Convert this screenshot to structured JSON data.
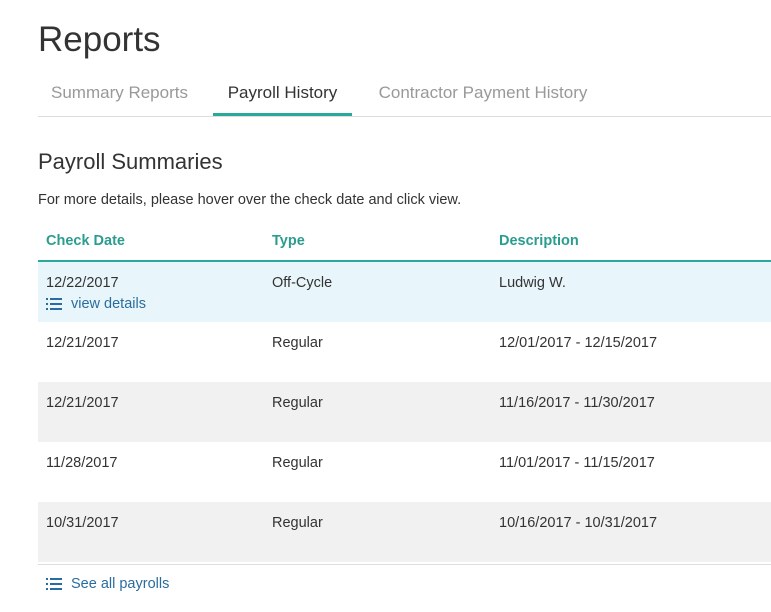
{
  "page": {
    "title": "Reports"
  },
  "tabs": [
    {
      "label": "Summary Reports",
      "active": false
    },
    {
      "label": "Payroll History",
      "active": true
    },
    {
      "label": "Contractor Payment History",
      "active": false
    }
  ],
  "section": {
    "title": "Payroll Summaries",
    "description": "For more details, please hover over the check date and click view."
  },
  "table": {
    "headers": {
      "check_date": "Check Date",
      "type": "Type",
      "description": "Description"
    },
    "rows": [
      {
        "check_date": "12/22/2017",
        "type": "Off-Cycle",
        "description": "Ludwig W.",
        "hovered": true,
        "action": "view details"
      },
      {
        "check_date": "12/21/2017",
        "type": "Regular",
        "description": "12/01/2017 - 12/15/2017"
      },
      {
        "check_date": "12/21/2017",
        "type": "Regular",
        "description": "11/16/2017 - 11/30/2017"
      },
      {
        "check_date": "11/28/2017",
        "type": "Regular",
        "description": "11/01/2017 - 11/15/2017"
      },
      {
        "check_date": "10/31/2017",
        "type": "Regular",
        "description": "10/16/2017 - 10/31/2017"
      }
    ]
  },
  "footer": {
    "see_all_label": "See all payrolls"
  },
  "colors": {
    "accent": "#2aa89a",
    "link": "#2b6c9e",
    "hover_row": "#e8f6fb",
    "striped_row": "#f1f1f1"
  },
  "icons": {
    "view_details": "list-icon",
    "see_all": "list-icon"
  }
}
